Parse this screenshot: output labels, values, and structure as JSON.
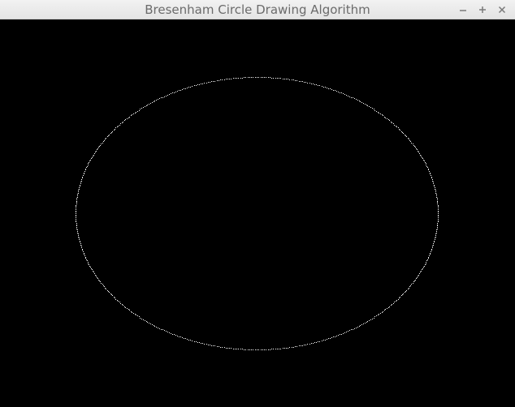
{
  "window": {
    "title": "Bresenham Circle Drawing Algorithm"
  },
  "controls": {
    "minimize_icon": "minimize-icon",
    "maximize_icon": "maximize-icon",
    "close_icon": "close-icon"
  },
  "colors": {
    "background": "#000000",
    "plot": "#ffffff",
    "titlebar_text": "#6b6b6b"
  }
}
